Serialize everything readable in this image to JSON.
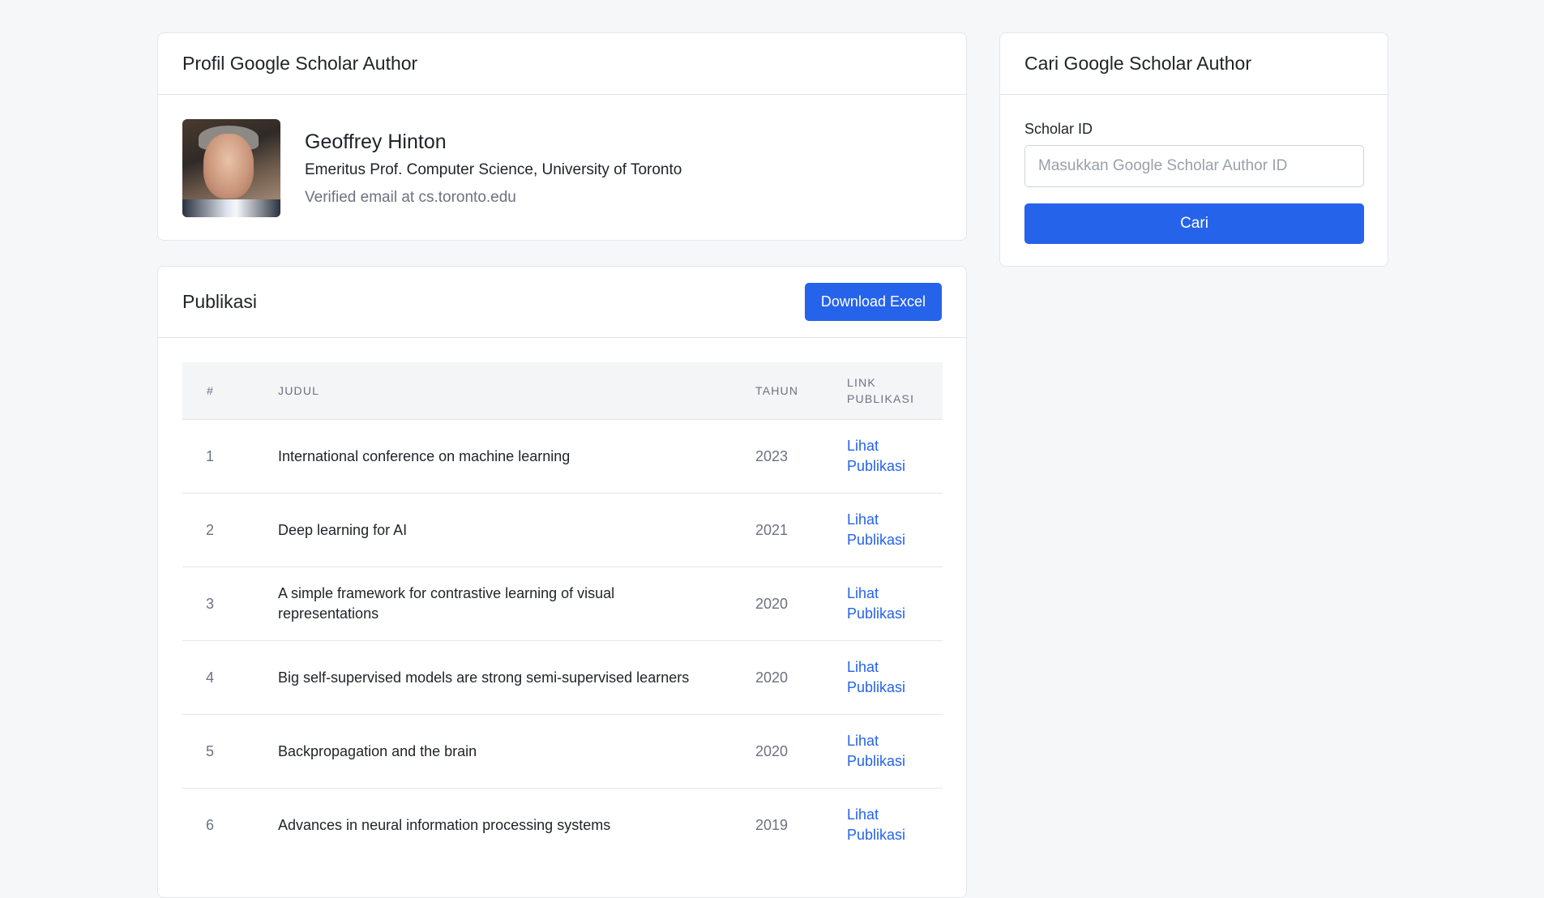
{
  "profile": {
    "header_title": "Profil Google Scholar Author",
    "name": "Geoffrey Hinton",
    "affiliation": "Emeritus Prof. Computer Science, University of Toronto",
    "email": "Verified email at cs.toronto.edu"
  },
  "publications": {
    "header_title": "Publikasi",
    "download_label": "Download Excel",
    "columns": {
      "num": "#",
      "title": "JUDUL",
      "year": "TAHUN",
      "link": "LINK PUBLIKASI"
    },
    "rows": [
      {
        "num": "1",
        "title": "International conference on machine learning",
        "year": "2023",
        "link": "Lihat Publikasi"
      },
      {
        "num": "2",
        "title": "Deep learning for AI",
        "year": "2021",
        "link": "Lihat Publikasi"
      },
      {
        "num": "3",
        "title": "A simple framework for contrastive learning of visual representations",
        "year": "2020",
        "link": "Lihat Publikasi"
      },
      {
        "num": "4",
        "title": "Big self-supervised models are strong semi-supervised learners",
        "year": "2020",
        "link": "Lihat Publikasi"
      },
      {
        "num": "5",
        "title": "Backpropagation and the brain",
        "year": "2020",
        "link": "Lihat Publikasi"
      },
      {
        "num": "6",
        "title": "Advances in neural information processing systems",
        "year": "2019",
        "link": "Lihat Publikasi"
      }
    ]
  },
  "search": {
    "header_title": "Cari Google Scholar Author",
    "field_label": "Scholar ID",
    "input_value": "",
    "input_placeholder": "Masukkan Google Scholar Author ID",
    "button_label": "Cari"
  },
  "colors": {
    "accent": "#2563eb",
    "page_background": "#f6f7f9",
    "muted_text": "#6b7280"
  }
}
